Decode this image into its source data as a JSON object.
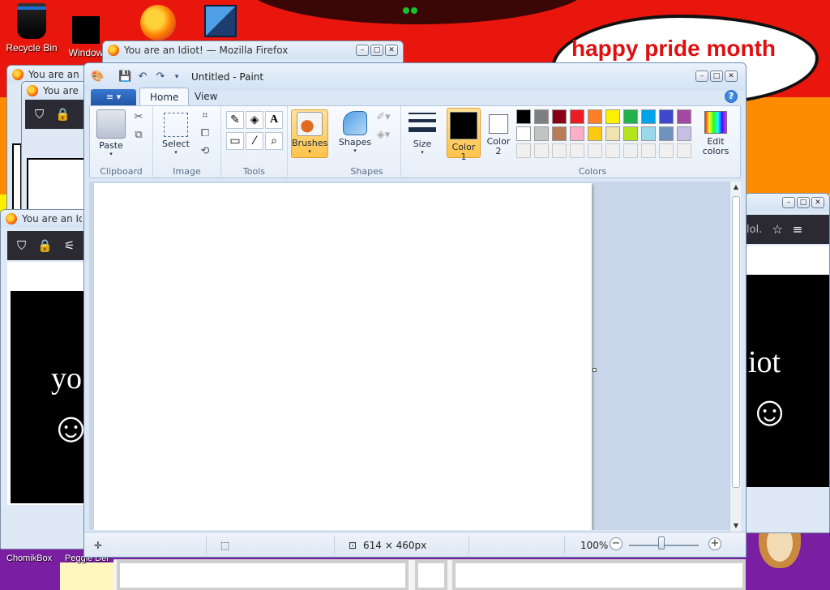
{
  "desktop": {
    "banner_text": "happy pride month",
    "icons": [
      {
        "label": "Recycle Bin",
        "icon": "recycle-bin-icon"
      },
      {
        "label": "Window",
        "icon": "black-box-icon"
      },
      {
        "label": "",
        "icon": "firefox-icon"
      },
      {
        "label": "",
        "icon": "virtualbox-icon"
      }
    ],
    "bottom_labels": [
      "ChomikBox",
      "Peggle Del"
    ]
  },
  "background_windows": {
    "firefox_title": "You are an Idiot! — Mozilla Firefox",
    "short_title_1": "You are an Id",
    "short_title_2": "You are a",
    "short_title_3": "You are an Idi",
    "content_text_left": "yo",
    "content_text_right": "iot",
    "smiley": "☺",
    "right_partial_text": "lol."
  },
  "paint": {
    "title": "Untitled - Paint",
    "file_menu_label": "≡ ▾",
    "tabs": [
      "Home",
      "View"
    ],
    "groups": {
      "clipboard": {
        "label": "Clipboard",
        "paste": "Paste"
      },
      "image": {
        "label": "Image",
        "select": "Select"
      },
      "tools": {
        "label": "Tools"
      },
      "brushes": {
        "label": "Brushes"
      },
      "shapes": {
        "label": "Shapes",
        "shapes_btn": "Shapes"
      },
      "size": {
        "label": "Size"
      },
      "colors": {
        "label": "Colors",
        "color1": "Color\n1",
        "color2": "Color\n2",
        "edit": "Edit\ncolors"
      }
    },
    "palette_row1": [
      "#000000",
      "#7f7f7f",
      "#880015",
      "#ed1c24",
      "#ff7f27",
      "#fff200",
      "#22b14c",
      "#00a2e8",
      "#3f48cc",
      "#a349a4"
    ],
    "palette_row2": [
      "#ffffff",
      "#c3c3c3",
      "#b97a57",
      "#ffaec9",
      "#ffc90e",
      "#efe4b0",
      "#b5e61d",
      "#99d9ea",
      "#7092be",
      "#c8bfe7"
    ],
    "color1_value": "#000000",
    "color2_value": "#ffffff",
    "status": {
      "canvas_size": "614 × 460px",
      "zoom": "100%"
    }
  }
}
